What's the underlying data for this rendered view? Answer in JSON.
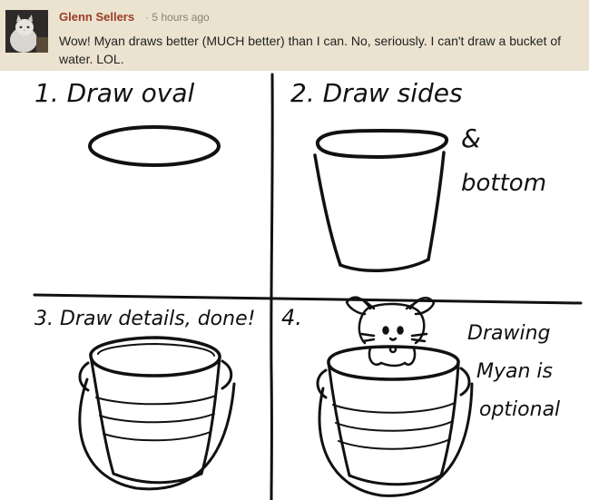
{
  "comment": {
    "author": "Glenn Sellers",
    "separator": "·",
    "timestamp": "5 hours ago",
    "text": "Wow! Myan draws better (MUCH better) than I can. No, seriously. I can't draw a bucket of water. LOL.",
    "avatar_icon": "cat-avatar"
  },
  "drawing": {
    "panel1_label": "1. Draw oval",
    "panel2_label_line1": "2. Draw sides",
    "panel2_label_line2": "&",
    "panel2_label_line3": "bottom",
    "panel3_label": "3. Draw details, done!",
    "panel4_label": "4.",
    "panel4_note_line1": "Drawing",
    "panel4_note_line2": "Myan is",
    "panel4_note_line3": "optional"
  }
}
